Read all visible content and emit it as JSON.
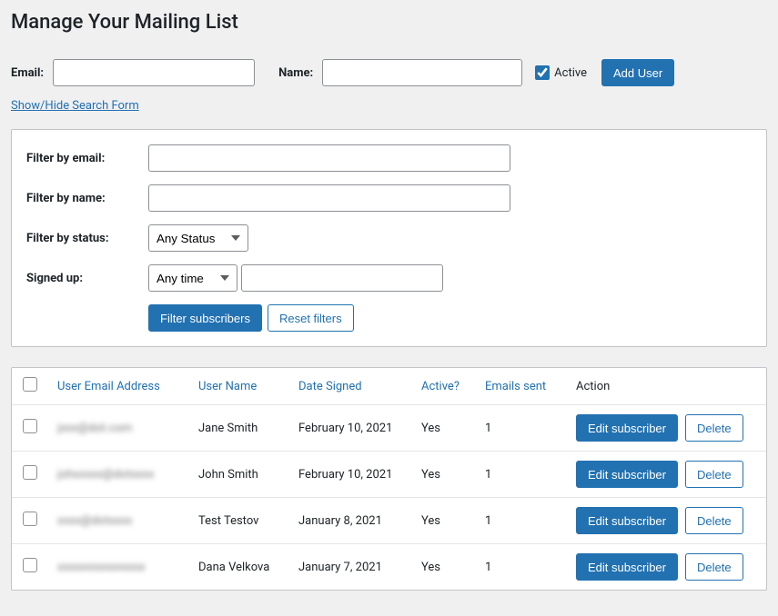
{
  "page_title": "Manage Your Mailing List",
  "top_form": {
    "email_label": "Email:",
    "name_label": "Name:",
    "active_label": "Active",
    "active_checked": true,
    "add_user_label": "Add User"
  },
  "toggle_link": "Show/Hide Search Form",
  "filters": {
    "email_label": "Filter by email:",
    "name_label": "Filter by name:",
    "status_label": "Filter by status:",
    "status_value": "Any Status",
    "signed_label": "Signed up:",
    "signed_value": "Any time",
    "filter_btn": "Filter subscribers",
    "reset_btn": "Reset filters"
  },
  "table": {
    "headers": {
      "email": "User Email Address",
      "name": "User Name",
      "date": "Date Signed",
      "active": "Active?",
      "sent": "Emails sent",
      "action": "Action"
    },
    "edit_label": "Edit subscriber",
    "delete_label": "Delete",
    "rows": [
      {
        "email": "jxxx@dot.com",
        "name": "Jane Smith",
        "date": "February 10, 2021",
        "active": "Yes",
        "sent": "1"
      },
      {
        "email": "johxxxxx@dotxxxx",
        "name": "John Smith",
        "date": "February 10, 2021",
        "active": "Yes",
        "sent": "1"
      },
      {
        "email": "xxxx@dotxxxx",
        "name": "Test Testov",
        "date": "January 8, 2021",
        "active": "Yes",
        "sent": "1"
      },
      {
        "email": "xxxxxxxxxxxxxxx",
        "name": "Dana Velkova",
        "date": "January 7, 2021",
        "active": "Yes",
        "sent": "1"
      }
    ]
  }
}
